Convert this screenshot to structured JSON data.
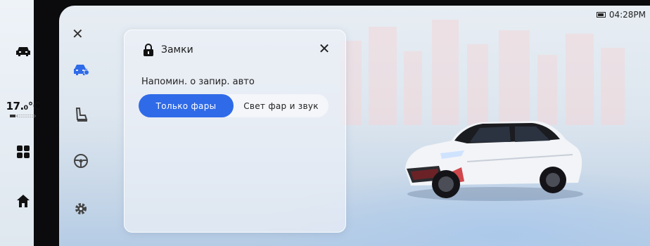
{
  "status": {
    "time": "04:28PM"
  },
  "dock": {
    "temperature": "17.₀℃",
    "items": [
      {
        "icon": "car-icon"
      },
      {
        "icon": "grid-icon"
      },
      {
        "icon": "home-icon"
      }
    ]
  },
  "settings_nav": {
    "items": [
      {
        "icon": "vehicle-settings-icon",
        "active": true
      },
      {
        "icon": "seat-icon",
        "active": false
      },
      {
        "icon": "steering-wheel-icon",
        "active": false
      },
      {
        "icon": "gear-icon",
        "active": false
      }
    ]
  },
  "panel": {
    "title": "Замки",
    "reminder_label": "Напомин. о запир. авто",
    "options": [
      {
        "label": "Только фары",
        "selected": true
      },
      {
        "label": "Свет фар и звук",
        "selected": false
      }
    ]
  },
  "colors": {
    "accent": "#2f6be8",
    "dock_bg": "#0b0b0d"
  }
}
